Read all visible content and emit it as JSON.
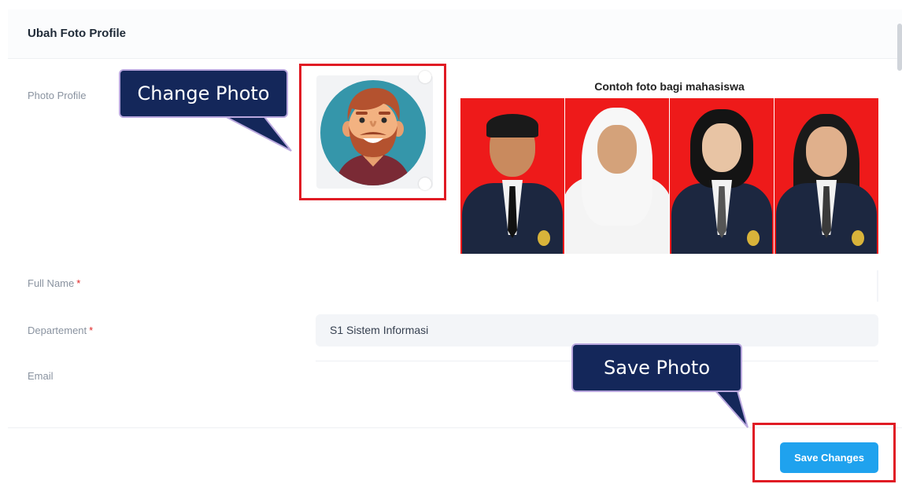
{
  "card": {
    "title": "Ubah Foto Profile"
  },
  "form": {
    "photo_label": "Photo Profile",
    "sample_caption": "Contoh foto bagi mahasiswa",
    "full_name_label": "Full Name",
    "full_name_value": "",
    "department_label": "Departement",
    "department_value": "S1 Sistem Informasi",
    "email_label": "Email",
    "email_value": "",
    "required_marker": "*"
  },
  "actions": {
    "save_label": "Save Changes"
  },
  "annotations": {
    "change_photo": "Change Photo",
    "save_photo": "Save Photo"
  },
  "colors": {
    "primary_button": "#1fa2ee",
    "highlight": "#e01b24",
    "callout_bg": "#14275a",
    "avatar_bg": "#3596aa"
  }
}
